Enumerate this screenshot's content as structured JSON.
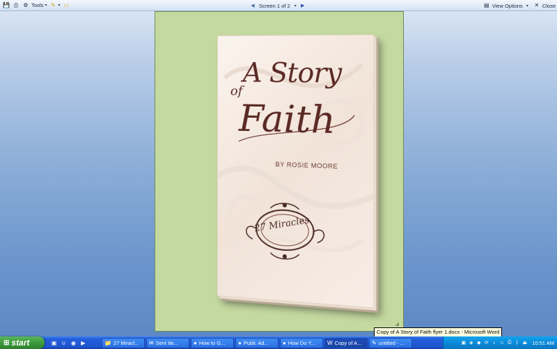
{
  "toolbar": {
    "tools_label": "Tools",
    "screen_label": "Screen 1 of 2",
    "view_options_label": "View Options",
    "close_label": "Close"
  },
  "flyer": {
    "title_line1": "A Story",
    "title_line2": "of",
    "title_line3": "Faith",
    "author": "BY ROSIE MOORE",
    "emblem_text": "27 Miracles"
  },
  "tooltip": "Copy of A Story of Faith flyer 1.docx - Microsoft Word",
  "taskbar": {
    "start_label": "start",
    "tasks": [
      {
        "label": "27 Miracl...",
        "icon": "folder-icon"
      },
      {
        "label": "Sent Ite...",
        "icon": "outlook-icon"
      },
      {
        "label": "How to G...",
        "icon": "firefox-icon"
      },
      {
        "label": "Publi: Ad...",
        "icon": "firefox-icon"
      },
      {
        "label": "How Do Y...",
        "icon": "firefox-icon"
      },
      {
        "label": "Copy of A...",
        "icon": "word-icon"
      },
      {
        "label": "untitled - ...",
        "icon": "paint-icon"
      }
    ],
    "clock": "10:51 AM"
  },
  "colors": {
    "page_bg": "#c4d9a0",
    "title_color": "#5a2a24",
    "taskbar_blue": "#245edb",
    "start_green": "#3c9a3c"
  }
}
